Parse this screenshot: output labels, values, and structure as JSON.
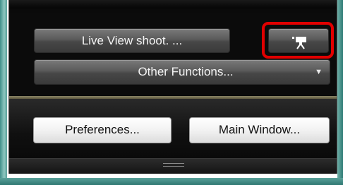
{
  "panel": {
    "live_view_button": {
      "label": "Live View shoot. ..."
    },
    "movie_button": {
      "icon": "movie-camera-icon"
    },
    "other_functions": {
      "label": "Other Functions...",
      "arrow": "▼"
    },
    "preferences_button": {
      "label": "Preferences..."
    },
    "main_window_button": {
      "label": "Main Window..."
    }
  },
  "colors": {
    "highlight": "#e20000",
    "panel_bg": "#0a0a0a",
    "divider": "#8a8466"
  }
}
